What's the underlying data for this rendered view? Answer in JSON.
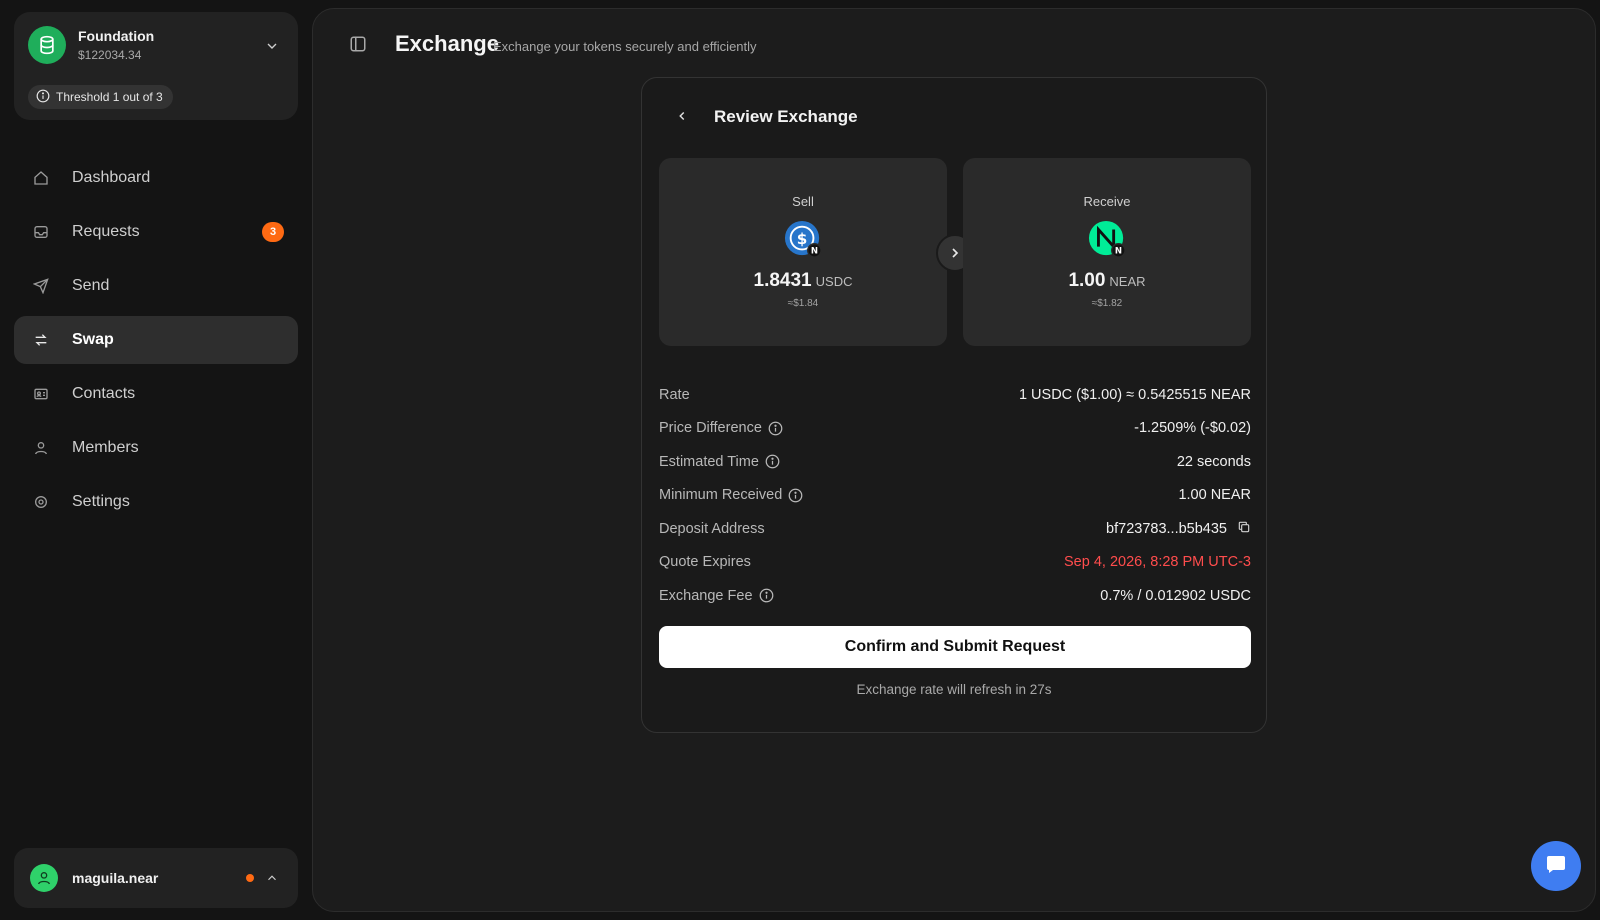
{
  "org": {
    "name": "Foundation",
    "balance": "$122034.34",
    "threshold": "Threshold 1 out of 3"
  },
  "nav": {
    "items": [
      {
        "label": "Dashboard",
        "icon": "home-icon"
      },
      {
        "label": "Requests",
        "icon": "inbox-icon",
        "badge": "3"
      },
      {
        "label": "Send",
        "icon": "send-icon"
      },
      {
        "label": "Swap",
        "icon": "swap-icon",
        "active": true
      },
      {
        "label": "Contacts",
        "icon": "contacts-icon"
      },
      {
        "label": "Members",
        "icon": "members-icon"
      },
      {
        "label": "Settings",
        "icon": "gear-icon"
      }
    ]
  },
  "user": {
    "name": "maguila.near"
  },
  "header": {
    "title": "Exchange",
    "subtitle": "Exchange your tokens securely and efficiently"
  },
  "review": {
    "title": "Review Exchange",
    "sell": {
      "label": "Sell",
      "amount": "1.8431",
      "symbol": "USDC",
      "usd": "≈$1.84",
      "icon": "usdc-icon"
    },
    "receive": {
      "label": "Receive",
      "amount": "1.00",
      "symbol": "NEAR",
      "usd": "≈$1.82",
      "icon": "near-icon"
    },
    "details": {
      "rate_label": "Rate",
      "rate_value": "1 USDC ($1.00) ≈ 0.5425515 NEAR",
      "price_diff_label": "Price Difference",
      "price_diff_value": "-1.2509% (-$0.02)",
      "est_time_label": "Estimated Time",
      "est_time_value": "22 seconds",
      "min_received_label": "Minimum Received",
      "min_received_value": "1.00 NEAR",
      "deposit_label": "Deposit Address",
      "deposit_value": "bf723783...b5b435",
      "expires_label": "Quote Expires",
      "expires_value": "Sep 4, 2026, 8:28 PM UTC-3",
      "fee_label": "Exchange Fee",
      "fee_value": "0.7% / 0.012902 USDC"
    },
    "confirm_label": "Confirm and Submit Request",
    "refresh_note": "Exchange rate will refresh in 27s"
  },
  "colors": {
    "accent_green": "#1fae5b",
    "badge_orange": "#ff6a13",
    "expiry_red": "#ff4d4d",
    "chat_blue": "#3f7df1"
  }
}
